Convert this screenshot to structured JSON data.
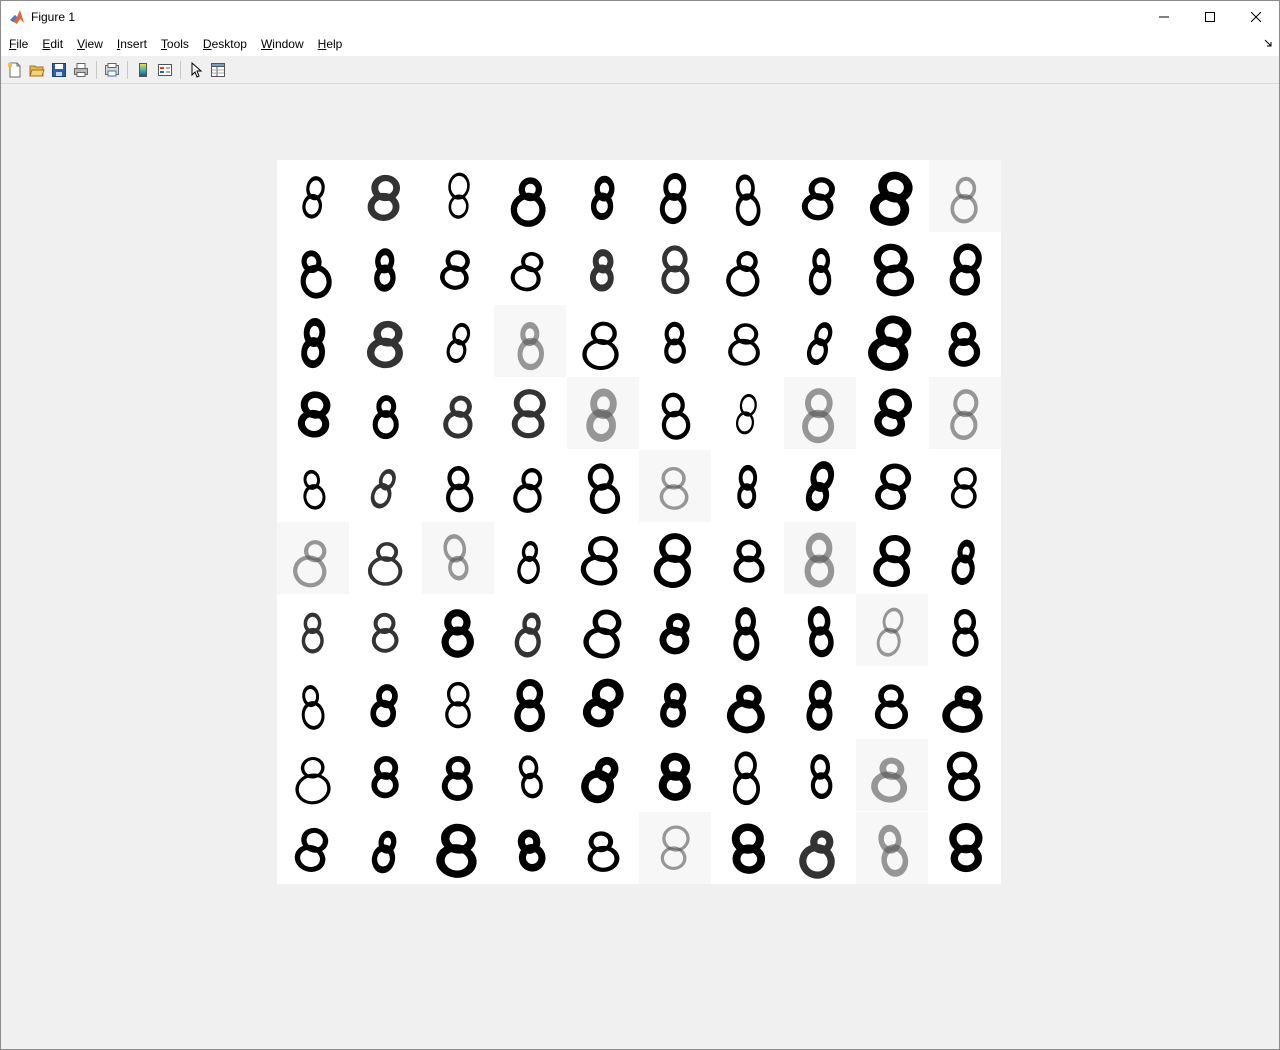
{
  "window": {
    "title": "Figure 1"
  },
  "menu": [
    "File",
    "Edit",
    "View",
    "Insert",
    "Tools",
    "Desktop",
    "Window",
    "Help"
  ],
  "toolbar": [
    "new-figure-icon",
    "open-file-icon",
    "save-icon",
    "print-icon",
    "print-preview-icon",
    "colorbar-icon",
    "legend-icon",
    "edit-plot-pointer-icon",
    "property-inspector-icon"
  ],
  "figure": {
    "type": "image-montage",
    "rows": 10,
    "cols": 10,
    "digit_label": "8"
  }
}
